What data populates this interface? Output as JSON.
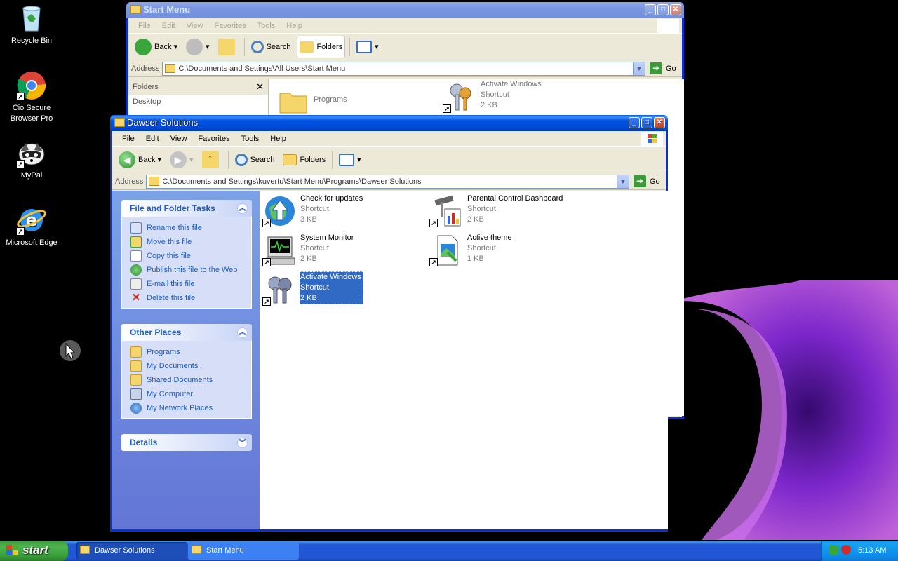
{
  "desktop": {
    "icons": [
      {
        "label": "Recycle Bin",
        "icon": "recycle-bin-icon"
      },
      {
        "label": "Cio Secure Browser Pro",
        "icon": "chrome-icon"
      },
      {
        "label": "MyPal",
        "icon": "raccoon-icon"
      },
      {
        "label": "Microsoft Edge",
        "icon": "internet-explorer-icon"
      }
    ]
  },
  "back_window": {
    "title": "Start Menu",
    "menu": [
      "File",
      "Edit",
      "View",
      "Favorites",
      "Tools",
      "Help"
    ],
    "toolbar": {
      "back": "Back",
      "search": "Search",
      "folders": "Folders"
    },
    "address_label": "Address",
    "address": "C:\\Documents and Settings\\All Users\\Start Menu",
    "go": "Go",
    "folders_pane_title": "Folders",
    "folders_tree": [
      "Desktop"
    ],
    "items": [
      {
        "name": "Programs",
        "type": "",
        "size": ""
      },
      {
        "name": "Activate Windows",
        "type": "Shortcut",
        "size": "2 KB"
      }
    ]
  },
  "front_window": {
    "title": "Dawser Solutions",
    "menu": [
      "File",
      "Edit",
      "View",
      "Favorites",
      "Tools",
      "Help"
    ],
    "toolbar": {
      "back": "Back",
      "search": "Search",
      "folders": "Folders"
    },
    "address_label": "Address",
    "address": "C:\\Documents and Settings\\kuvertu\\Start Menu\\Programs\\Dawser Solutions",
    "go": "Go",
    "file_tasks": {
      "title": "File and Folder Tasks",
      "items": [
        "Rename this file",
        "Move this file",
        "Copy this file",
        "Publish this file to the Web",
        "E-mail this file",
        "Delete this file"
      ]
    },
    "other_places": {
      "title": "Other Places",
      "items": [
        "Programs",
        "My Documents",
        "Shared Documents",
        "My Computer",
        "My Network Places"
      ]
    },
    "details": {
      "title": "Details"
    },
    "files": [
      {
        "name": "Check for updates",
        "type": "Shortcut",
        "size": "3 KB",
        "icon": "update-globe-icon"
      },
      {
        "name": "Parental Control Dashboard",
        "type": "Shortcut",
        "size": "2 KB",
        "icon": "tools-chart-icon"
      },
      {
        "name": "System Monitor",
        "type": "Shortcut",
        "size": "2 KB",
        "icon": "monitor-icon"
      },
      {
        "name": "Active theme",
        "type": "Shortcut",
        "size": "1 KB",
        "icon": "theme-document-icon"
      },
      {
        "name": "Activate Windows",
        "type": "Shortcut",
        "size": "2 KB",
        "icon": "keys-icon",
        "selected": true
      }
    ]
  },
  "taskbar": {
    "start_label": "start",
    "tasks": [
      "Dawser Solutions",
      "Start Menu"
    ],
    "clock": "5:13 AM"
  },
  "colors": {
    "title_active": "#0054e3",
    "task_pane": "#6d8ce0",
    "selection": "#316ac5",
    "start_green": "#3c9a3c"
  }
}
